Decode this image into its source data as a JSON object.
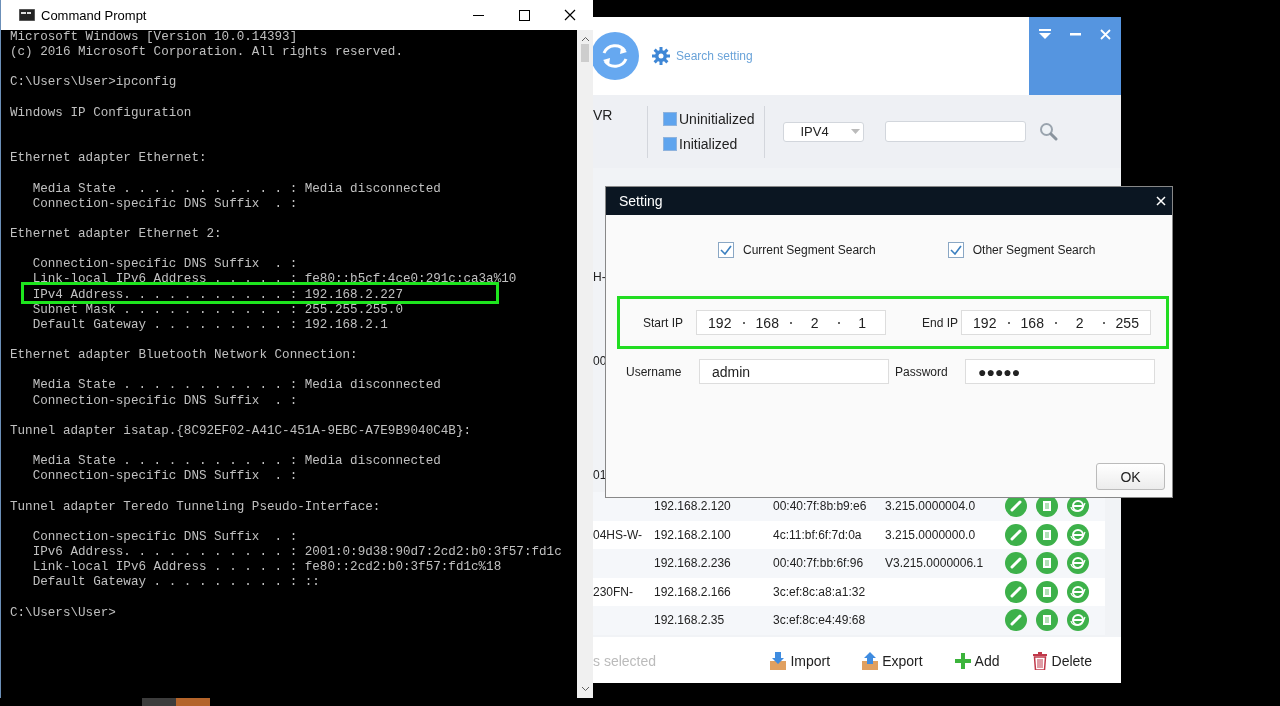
{
  "cmd_window": {
    "title": "Command Prompt",
    "blocks": [
      {
        "kind": "text",
        "lines": [
          {
            "text": "Microsoft Windows [Version 10.0.14393]"
          },
          {
            "text": "(c) 2016 Microsoft Corporation. All rights reserved."
          }
        ]
      },
      {
        "kind": "text",
        "lines": [
          {
            "text": "C:\\Users\\User>ipconfig"
          }
        ]
      },
      {
        "kind": "title",
        "lines": [
          {
            "text": "Windows IP Configuration"
          }
        ]
      },
      {
        "kind": "text",
        "lines": [
          {
            "text": "Ethernet adapter Ethernet:"
          }
        ]
      },
      {
        "kind": "text",
        "lines": [
          {
            "text": "   Media State . . . . . . . . . . . : Media disconnected"
          },
          {
            "text": "   Connection-specific DNS Suffix  . :"
          }
        ]
      },
      {
        "kind": "text",
        "lines": [
          {
            "text": "Ethernet adapter Ethernet 2:"
          }
        ]
      },
      {
        "kind": "text",
        "lines": [
          {
            "text": "   Connection-specific DNS Suffix  . :",
            "highlighted": false
          },
          {
            "text": "   Link-local IPv6 Address . . . . . : fe80::b5cf:4ce0:291c:ca3a%10",
            "highlighted": false
          },
          {
            "text": "   IPv4 Address. . . . . . . . . . . : 192.168.2.227",
            "highlighted": true
          },
          {
            "text": "   Subnet Mask . . . . . . . . . . . : 255.255.255.0",
            "highlighted": false
          },
          {
            "text": "   Default Gateway . . . . . . . . . : 192.168.2.1",
            "highlighted": false
          }
        ]
      },
      {
        "kind": "text",
        "lines": [
          {
            "text": "Ethernet adapter Bluetooth Network Connection:"
          }
        ]
      },
      {
        "kind": "text",
        "lines": [
          {
            "text": "   Media State . . . . . . . . . . . : Media disconnected"
          },
          {
            "text": "   Connection-specific DNS Suffix  . :"
          }
        ]
      },
      {
        "kind": "text",
        "lines": [
          {
            "text": "Tunnel adapter isatap.{8C92EF02-A41C-451A-9EBC-A7E9B9040C4B}:"
          }
        ]
      },
      {
        "kind": "text",
        "lines": [
          {
            "text": "   Media State . . . . . . . . . . . : Media disconnected"
          },
          {
            "text": "   Connection-specific DNS Suffix  . :"
          }
        ]
      },
      {
        "kind": "text",
        "lines": [
          {
            "text": "Tunnel adapter Teredo Tunneling Pseudo-Interface:"
          }
        ]
      },
      {
        "kind": "text",
        "lines": [
          {
            "text": "   Connection-specific DNS Suffix  . :"
          },
          {
            "text": "   IPv6 Address. . . . . . . . . . . : 2001:0:9d38:90d7:2cd2:b0:3f57:fd1c"
          },
          {
            "text": "   Link-local IPv6 Address . . . . . : fe80::2cd2:b0:3f57:fd1c%18"
          },
          {
            "text": "   Default Gateway . . . . . . . . . : ::"
          }
        ]
      },
      {
        "kind": "text",
        "lines": [
          {
            "text": "C:\\Users\\User>"
          }
        ]
      }
    ]
  },
  "app_window": {
    "search_setting": "Search setting",
    "toolbar": {
      "device_type": "VR",
      "filters": [
        {
          "label": "Uninitialized",
          "checked": true
        },
        {
          "label": "Initialized",
          "checked": true
        }
      ],
      "protocol": "IPV4"
    },
    "covered_rows": [
      "H-",
      "00",
      "01"
    ],
    "rows": [
      {
        "ip": "192.168.2.120",
        "mac": "00:40:7f:8b:b9:e6",
        "version": "3.215.0000004.0"
      },
      {
        "name": "04HS-W-",
        "ip": "192.168.2.100",
        "mac": "4c:11:bf:6f:7d:0a",
        "version": "3.215.0000000.0"
      },
      {
        "ip": "192.168.2.236",
        "mac": "00:40:7f:bb:6f:96",
        "version": "V3.215.0000006.1"
      },
      {
        "name": "230FN-",
        "ip": "192.168.2.166",
        "mac": "3c:ef:8c:a8:a1:32"
      },
      {
        "ip": "192.168.2.35",
        "mac": "3c:ef:8c:e4:49:68"
      }
    ],
    "selection_status": "s selected",
    "actions": [
      {
        "kind": "import",
        "label": "Import"
      },
      {
        "kind": "export",
        "label": "Export"
      },
      {
        "kind": "add",
        "label": "Add"
      },
      {
        "kind": "delete",
        "label": "Delete"
      }
    ]
  },
  "setting_dialog": {
    "title": "Setting",
    "options": [
      {
        "label": "Current Segment Search",
        "checked": true
      },
      {
        "label": "Other Segment Search",
        "checked": true
      }
    ],
    "ip_range": {
      "highlighted": true,
      "start_label": "Start IP",
      "start": [
        "192",
        "168",
        "2",
        "1"
      ],
      "end_label": "End IP",
      "end": [
        "192",
        "168",
        "2",
        "255"
      ]
    },
    "username_label": "Username",
    "username": "admin",
    "password_label": "Password",
    "password": "●●●●●",
    "ok": "OK"
  },
  "taskbar": [
    {
      "color": "#3c3c3c"
    },
    {
      "color": "#b4642a"
    }
  ]
}
